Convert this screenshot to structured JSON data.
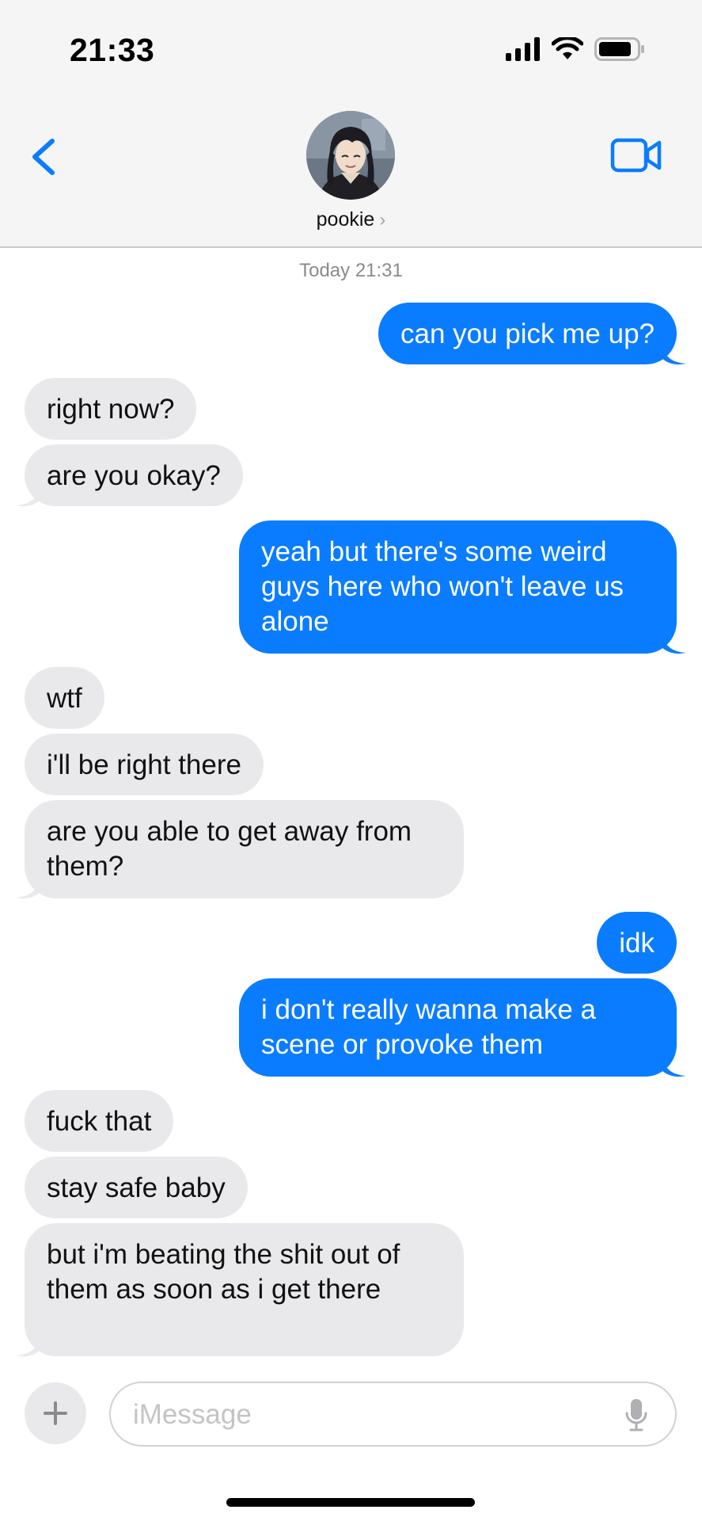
{
  "status_bar": {
    "time": "21:33",
    "icons": [
      "signal-bars-icon",
      "wifi-icon",
      "battery-icon"
    ]
  },
  "header": {
    "contact_name": "pookie",
    "chevron": "›",
    "back_icon": "chevron-left-icon",
    "video_icon": "video-camera-icon",
    "avatar": "contact-avatar"
  },
  "conversation": {
    "timestamp": "Today 21:31",
    "messages": [
      {
        "from": "me",
        "text": "can you pick me up?"
      },
      {
        "from": "them",
        "text": "right now?"
      },
      {
        "from": "them",
        "text": "are you okay?"
      },
      {
        "from": "me",
        "text": "yeah but there's some weird guys here who won't leave us alone"
      },
      {
        "from": "them",
        "text": "wtf"
      },
      {
        "from": "them",
        "text": "i'll be right there"
      },
      {
        "from": "them",
        "text": "are you able to get away from them?"
      },
      {
        "from": "me",
        "text": "idk"
      },
      {
        "from": "me",
        "text": "i don't really wanna make a scene or provoke them"
      },
      {
        "from": "them",
        "text": "fuck that"
      },
      {
        "from": "them",
        "text": "stay safe baby"
      },
      {
        "from": "them",
        "text": "but i'm beating the shit out of them as soon as i get there"
      }
    ]
  },
  "composer": {
    "placeholder": "iMessage",
    "plus_label": "+",
    "mic_icon": "microphone-icon"
  },
  "colors": {
    "outgoing_bubble": "#0a7cff",
    "incoming_bubble": "#e9e9eb",
    "accent": "#0a7cff",
    "header_bg": "#f5f5f5"
  }
}
